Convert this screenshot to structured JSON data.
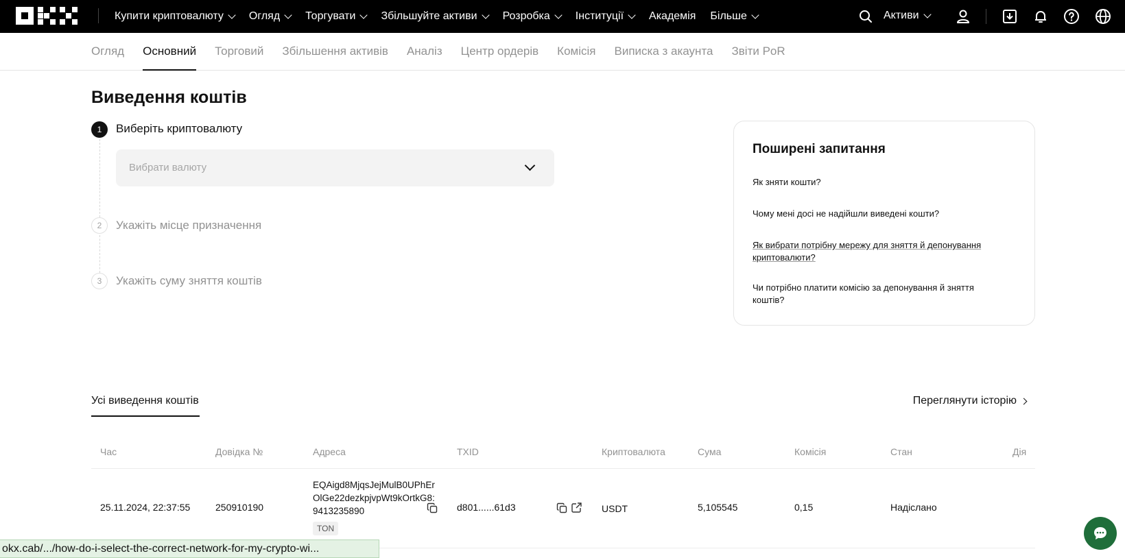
{
  "topnav": {
    "items": [
      {
        "label": "Купити криптовалюту",
        "dropdown": true
      },
      {
        "label": "Огляд",
        "dropdown": true
      },
      {
        "label": "Торгувати",
        "dropdown": true
      },
      {
        "label": "Збільшуйте активи",
        "dropdown": true
      },
      {
        "label": "Розробка",
        "dropdown": true
      },
      {
        "label": "Інституції",
        "dropdown": true
      },
      {
        "label": "Академія",
        "dropdown": false
      },
      {
        "label": "Більше",
        "dropdown": true
      }
    ],
    "assets_label": "Активи",
    "icons": [
      "search-icon",
      "user-icon",
      "download-icon",
      "bell-icon",
      "help-icon",
      "globe-icon"
    ]
  },
  "subnav": {
    "tabs": [
      {
        "label": "Огляд",
        "active": false
      },
      {
        "label": "Основний",
        "active": true
      },
      {
        "label": "Торговий",
        "active": false
      },
      {
        "label": "Збільшення активів",
        "active": false
      },
      {
        "label": "Аналіз",
        "active": false
      },
      {
        "label": "Центр ордерів",
        "active": false
      },
      {
        "label": "Комісія",
        "active": false
      },
      {
        "label": "Виписка з акаунта",
        "active": false
      },
      {
        "label": "Звіти PoR",
        "active": false
      }
    ]
  },
  "page": {
    "title": "Виведення коштів"
  },
  "steps": [
    {
      "number": "1",
      "label": "Виберіть криптовалюту",
      "active": true
    },
    {
      "number": "2",
      "label": "Укажіть місце призначення",
      "active": false
    },
    {
      "number": "3",
      "label": "Укажіть суму зняття коштів",
      "active": false
    }
  ],
  "currency_select": {
    "placeholder": "Вибрати валюту"
  },
  "faq": {
    "title": "Поширені запитання",
    "questions": [
      "Як зняти кошти?",
      "Чому мені досі не надійшли виведені кошти?",
      "Як вибрати потрібну мережу для зняття й депонування криптовалюти?",
      "Чи потрібно платити комісію за депонування й зняття коштів?"
    ]
  },
  "withdrawals": {
    "tab_label": "Усі виведення коштів",
    "history_link": "Переглянути історію",
    "columns": [
      "Час",
      "Довідка №",
      "Адреса",
      "TXID",
      "Криптовалюта",
      "Сума",
      "Комісія",
      "Стан",
      "Дія"
    ],
    "rows": [
      {
        "time": "25.11.2024, 22:37:55",
        "reference": "250910190",
        "address": "EQAigd8MjqsJejMulB0UPhErOlGe22dezkpjvpWt9kOrtkG8:9413235890",
        "network_tag": "TON",
        "txid": "d801......61d3",
        "currency": "USDT",
        "amount": "5,105545",
        "fee": "0,15",
        "status": "Надіслано"
      }
    ]
  },
  "status_bar": {
    "url": "okx.cab/.../how-do-i-select-the-correct-network-for-my-crypto-wi..."
  },
  "colors": {
    "nav_bg": "#000000",
    "text": "#121212",
    "muted": "#929292",
    "chat_button": "#1f6e3a"
  }
}
